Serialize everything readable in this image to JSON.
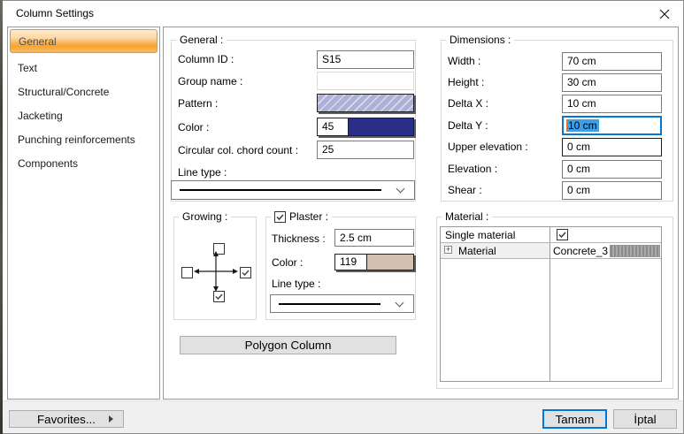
{
  "window": {
    "title": "Column Settings"
  },
  "sidebar": {
    "items": [
      "General",
      "Text",
      "Structural/Concrete",
      "Jacketing",
      "Punching reinforcements",
      "Components"
    ],
    "selected_index": 0
  },
  "general": {
    "legend": "General :",
    "column_id": {
      "label": "Column ID :",
      "value": "S15"
    },
    "group_name": {
      "label": "Group name :",
      "value": ""
    },
    "pattern": {
      "label": "Pattern :",
      "fill_color": "#aeb0d6",
      "style": "diagonal-hatch"
    },
    "color": {
      "label": "Color :",
      "index": "45",
      "swatch_hex": "#2b2e85"
    },
    "chord_count": {
      "label": "Circular col. chord count :",
      "value": "25"
    },
    "line_type": {
      "label": "Line type :",
      "selected": "solid-line"
    }
  },
  "growing": {
    "legend": "Growing :",
    "checkboxes": {
      "top": false,
      "left": false,
      "right": true,
      "bottom": true
    }
  },
  "plaster": {
    "legend": "Plaster :",
    "enabled": true,
    "thickness": {
      "label": "Thickness :",
      "value": "2.5 cm"
    },
    "color": {
      "label": "Color :",
      "index": "119",
      "swatch_hex": "#d4c0af"
    },
    "line_type": {
      "label": "Line type :",
      "selected": "solid-line"
    }
  },
  "polygon_column_button": "Polygon Column",
  "dimensions": {
    "legend": "Dimensions :",
    "rows": [
      {
        "label": "Width :",
        "value": "70 cm"
      },
      {
        "label": "Height :",
        "value": "30 cm"
      },
      {
        "label": "Delta X :",
        "value": "10 cm"
      },
      {
        "label": "Delta Y :",
        "value": "10 cm",
        "focused": true,
        "text_selected": true
      },
      {
        "label": "Upper elevation :",
        "value": "0 cm"
      },
      {
        "label": "Elevation :",
        "value": "0 cm"
      },
      {
        "label": "Shear :",
        "value": "0 cm"
      }
    ]
  },
  "material": {
    "legend": "Material :",
    "header": {
      "label": "Single material",
      "checked": true
    },
    "row": {
      "label": "Material",
      "value": "Concrete_3",
      "expandable": true
    }
  },
  "footer": {
    "favorites": "Favorites...",
    "ok": "Tamam",
    "cancel": "İptal"
  },
  "icons": {
    "expand": "+"
  },
  "colors": {
    "accent_focus": "#0078d7",
    "text_selection": "#3d9fe8",
    "sidebar_selected_top": "#fdeacb",
    "sidebar_selected_bottom": "#f6a62f",
    "pattern_swatch": "#aeb0d6",
    "color_swatch": "#2b2e85",
    "plaster_swatch": "#d4c0af"
  }
}
